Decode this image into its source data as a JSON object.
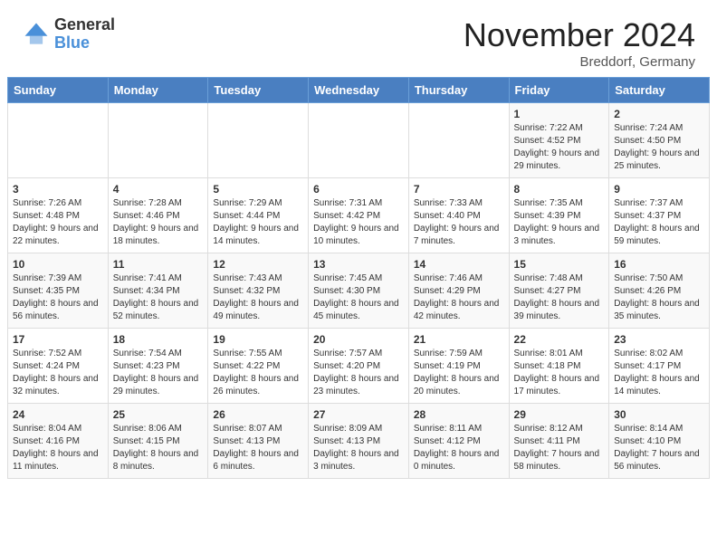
{
  "header": {
    "logo_general": "General",
    "logo_blue": "Blue",
    "title": "November 2024",
    "location": "Breddorf, Germany"
  },
  "days_of_week": [
    "Sunday",
    "Monday",
    "Tuesday",
    "Wednesday",
    "Thursday",
    "Friday",
    "Saturday"
  ],
  "weeks": [
    [
      {
        "day": "",
        "info": ""
      },
      {
        "day": "",
        "info": ""
      },
      {
        "day": "",
        "info": ""
      },
      {
        "day": "",
        "info": ""
      },
      {
        "day": "",
        "info": ""
      },
      {
        "day": "1",
        "info": "Sunrise: 7:22 AM\nSunset: 4:52 PM\nDaylight: 9 hours and 29 minutes."
      },
      {
        "day": "2",
        "info": "Sunrise: 7:24 AM\nSunset: 4:50 PM\nDaylight: 9 hours and 25 minutes."
      }
    ],
    [
      {
        "day": "3",
        "info": "Sunrise: 7:26 AM\nSunset: 4:48 PM\nDaylight: 9 hours and 22 minutes."
      },
      {
        "day": "4",
        "info": "Sunrise: 7:28 AM\nSunset: 4:46 PM\nDaylight: 9 hours and 18 minutes."
      },
      {
        "day": "5",
        "info": "Sunrise: 7:29 AM\nSunset: 4:44 PM\nDaylight: 9 hours and 14 minutes."
      },
      {
        "day": "6",
        "info": "Sunrise: 7:31 AM\nSunset: 4:42 PM\nDaylight: 9 hours and 10 minutes."
      },
      {
        "day": "7",
        "info": "Sunrise: 7:33 AM\nSunset: 4:40 PM\nDaylight: 9 hours and 7 minutes."
      },
      {
        "day": "8",
        "info": "Sunrise: 7:35 AM\nSunset: 4:39 PM\nDaylight: 9 hours and 3 minutes."
      },
      {
        "day": "9",
        "info": "Sunrise: 7:37 AM\nSunset: 4:37 PM\nDaylight: 8 hours and 59 minutes."
      }
    ],
    [
      {
        "day": "10",
        "info": "Sunrise: 7:39 AM\nSunset: 4:35 PM\nDaylight: 8 hours and 56 minutes."
      },
      {
        "day": "11",
        "info": "Sunrise: 7:41 AM\nSunset: 4:34 PM\nDaylight: 8 hours and 52 minutes."
      },
      {
        "day": "12",
        "info": "Sunrise: 7:43 AM\nSunset: 4:32 PM\nDaylight: 8 hours and 49 minutes."
      },
      {
        "day": "13",
        "info": "Sunrise: 7:45 AM\nSunset: 4:30 PM\nDaylight: 8 hours and 45 minutes."
      },
      {
        "day": "14",
        "info": "Sunrise: 7:46 AM\nSunset: 4:29 PM\nDaylight: 8 hours and 42 minutes."
      },
      {
        "day": "15",
        "info": "Sunrise: 7:48 AM\nSunset: 4:27 PM\nDaylight: 8 hours and 39 minutes."
      },
      {
        "day": "16",
        "info": "Sunrise: 7:50 AM\nSunset: 4:26 PM\nDaylight: 8 hours and 35 minutes."
      }
    ],
    [
      {
        "day": "17",
        "info": "Sunrise: 7:52 AM\nSunset: 4:24 PM\nDaylight: 8 hours and 32 minutes."
      },
      {
        "day": "18",
        "info": "Sunrise: 7:54 AM\nSunset: 4:23 PM\nDaylight: 8 hours and 29 minutes."
      },
      {
        "day": "19",
        "info": "Sunrise: 7:55 AM\nSunset: 4:22 PM\nDaylight: 8 hours and 26 minutes."
      },
      {
        "day": "20",
        "info": "Sunrise: 7:57 AM\nSunset: 4:20 PM\nDaylight: 8 hours and 23 minutes."
      },
      {
        "day": "21",
        "info": "Sunrise: 7:59 AM\nSunset: 4:19 PM\nDaylight: 8 hours and 20 minutes."
      },
      {
        "day": "22",
        "info": "Sunrise: 8:01 AM\nSunset: 4:18 PM\nDaylight: 8 hours and 17 minutes."
      },
      {
        "day": "23",
        "info": "Sunrise: 8:02 AM\nSunset: 4:17 PM\nDaylight: 8 hours and 14 minutes."
      }
    ],
    [
      {
        "day": "24",
        "info": "Sunrise: 8:04 AM\nSunset: 4:16 PM\nDaylight: 8 hours and 11 minutes."
      },
      {
        "day": "25",
        "info": "Sunrise: 8:06 AM\nSunset: 4:15 PM\nDaylight: 8 hours and 8 minutes."
      },
      {
        "day": "26",
        "info": "Sunrise: 8:07 AM\nSunset: 4:13 PM\nDaylight: 8 hours and 6 minutes."
      },
      {
        "day": "27",
        "info": "Sunrise: 8:09 AM\nSunset: 4:13 PM\nDaylight: 8 hours and 3 minutes."
      },
      {
        "day": "28",
        "info": "Sunrise: 8:11 AM\nSunset: 4:12 PM\nDaylight: 8 hours and 0 minutes."
      },
      {
        "day": "29",
        "info": "Sunrise: 8:12 AM\nSunset: 4:11 PM\nDaylight: 7 hours and 58 minutes."
      },
      {
        "day": "30",
        "info": "Sunrise: 8:14 AM\nSunset: 4:10 PM\nDaylight: 7 hours and 56 minutes."
      }
    ]
  ]
}
